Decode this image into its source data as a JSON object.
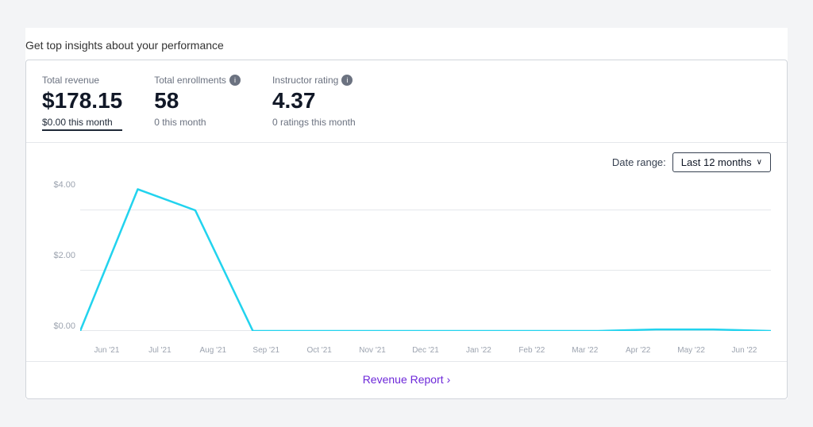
{
  "page": {
    "header": "Get top insights about your performance"
  },
  "metrics": [
    {
      "id": "total-revenue",
      "label": "Total revenue",
      "has_info": false,
      "value": "$178.15",
      "sub": "$0.00 this month",
      "active": true
    },
    {
      "id": "total-enrollments",
      "label": "Total enrollments",
      "has_info": true,
      "value": "58",
      "sub": "0 this month",
      "active": false
    },
    {
      "id": "instructor-rating",
      "label": "Instructor rating",
      "has_info": true,
      "value": "4.37",
      "sub": "0 ratings this month",
      "active": false
    }
  ],
  "chart": {
    "date_range_label": "Date range:",
    "date_range_value": "Last 12 months",
    "y_labels": [
      "$0.00",
      "$2.00",
      "$4.00"
    ],
    "x_labels": [
      "Jun '21",
      "Jul '21",
      "Aug '21",
      "Sep '21",
      "Oct '21",
      "Nov '21",
      "Dec '21",
      "Jan '22",
      "Feb '22",
      "Mar '22",
      "Apr '22",
      "May '22",
      "Jun '22"
    ],
    "data_points": [
      {
        "month": "Jun '21",
        "value": 0
      },
      {
        "month": "Jul '21",
        "value": 4.7
      },
      {
        "month": "Aug '21",
        "value": 4.0
      },
      {
        "month": "Sep '21",
        "value": 0
      },
      {
        "month": "Oct '21",
        "value": 0
      },
      {
        "month": "Nov '21",
        "value": 0
      },
      {
        "month": "Dec '21",
        "value": 0
      },
      {
        "month": "Jan '22",
        "value": 0
      },
      {
        "month": "Feb '22",
        "value": 0
      },
      {
        "month": "Mar '22",
        "value": 0
      },
      {
        "month": "Apr '22",
        "value": 0.05
      },
      {
        "month": "May '22",
        "value": 0.05
      },
      {
        "month": "Jun '22",
        "value": 0
      }
    ],
    "max_value": 5.0
  },
  "footer": {
    "revenue_report_label": "Revenue Report",
    "chevron": "›"
  }
}
